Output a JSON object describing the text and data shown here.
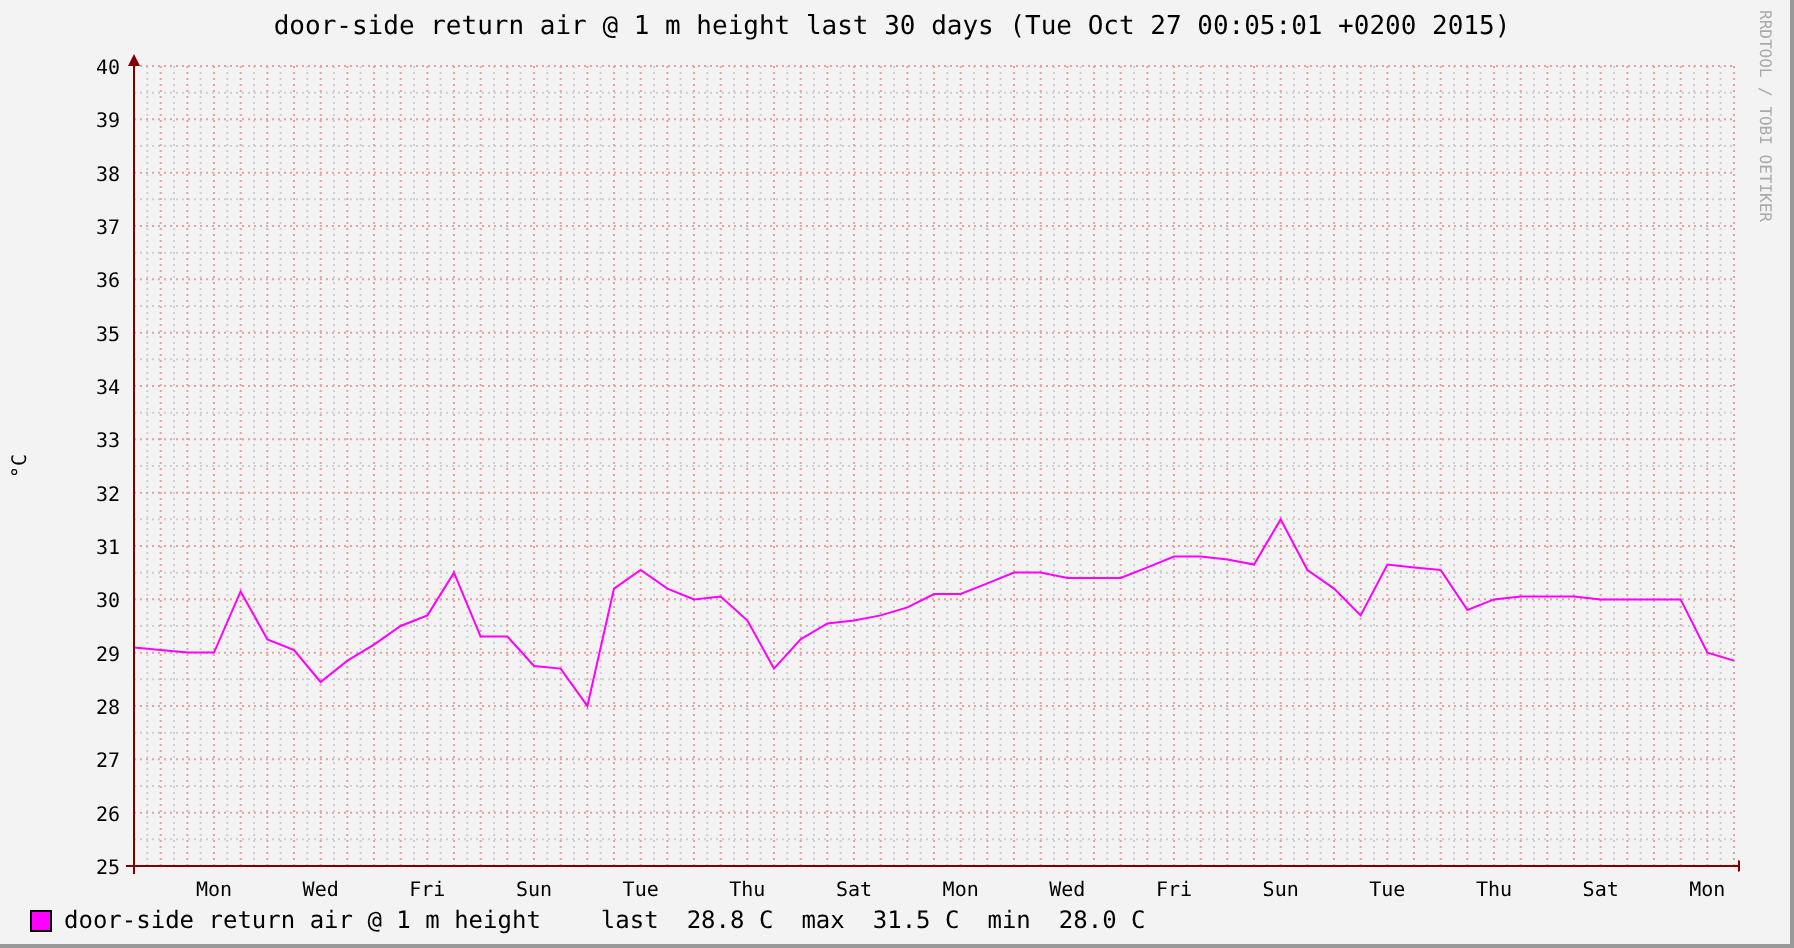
{
  "title": "door-side return air @ 1 m height last 30 days (Tue Oct 27 00:05:01 +0200 2015)",
  "side_text": "RRDTOOL / TOBI OETIKER",
  "chart": {
    "chart_data": {
      "type": "line",
      "grid": true,
      "ylabel": "°C",
      "ylim": [
        25,
        40
      ],
      "yticks": [
        25,
        26,
        27,
        28,
        29,
        30,
        31,
        32,
        33,
        34,
        35,
        36,
        37,
        38,
        39,
        40
      ],
      "categories": [
        null,
        null,
        null,
        "Mon",
        null,
        null,
        null,
        "Wed",
        null,
        null,
        null,
        "Fri",
        null,
        null,
        null,
        "Sun",
        null,
        null,
        null,
        "Tue",
        null,
        null,
        null,
        "Thu",
        null,
        null,
        null,
        "Sat",
        null,
        null,
        null,
        "Mon",
        null,
        null,
        null,
        "Wed",
        null,
        null,
        null,
        "Fri",
        null,
        null,
        null,
        "Sun",
        null,
        null,
        null,
        "Tue",
        null,
        null,
        null,
        "Thu",
        null,
        null,
        null,
        "Sat",
        null,
        null,
        null,
        "Mon",
        null
      ],
      "series": [
        {
          "name": "door-side return air @ 1 m height",
          "color": "#ff00ff",
          "values": [
            29.1,
            29.05,
            29.0,
            29.0,
            30.15,
            29.25,
            29.05,
            28.45,
            28.85,
            29.15,
            29.5,
            29.7,
            30.5,
            29.3,
            29.3,
            28.75,
            28.7,
            28.0,
            30.2,
            30.55,
            30.2,
            30.0,
            30.05,
            29.6,
            28.7,
            29.25,
            29.55,
            29.6,
            29.7,
            29.85,
            30.1,
            30.1,
            30.3,
            30.5,
            30.5,
            30.4,
            30.4,
            30.4,
            30.6,
            30.8,
            30.8,
            30.75,
            30.65,
            31.5,
            30.55,
            30.2,
            29.7,
            30.65,
            30.6,
            30.55,
            29.8,
            30.0,
            30.05,
            30.05,
            30.05,
            30.0,
            30.0,
            30.0,
            30.0,
            29.0,
            28.85
          ]
        }
      ]
    }
  },
  "legend": {
    "stats": [
      {
        "label": "last",
        "value": "28.8 C"
      },
      {
        "label": "max",
        "value": "31.5 C"
      },
      {
        "label": "min",
        "value": "28.0 C"
      }
    ]
  }
}
